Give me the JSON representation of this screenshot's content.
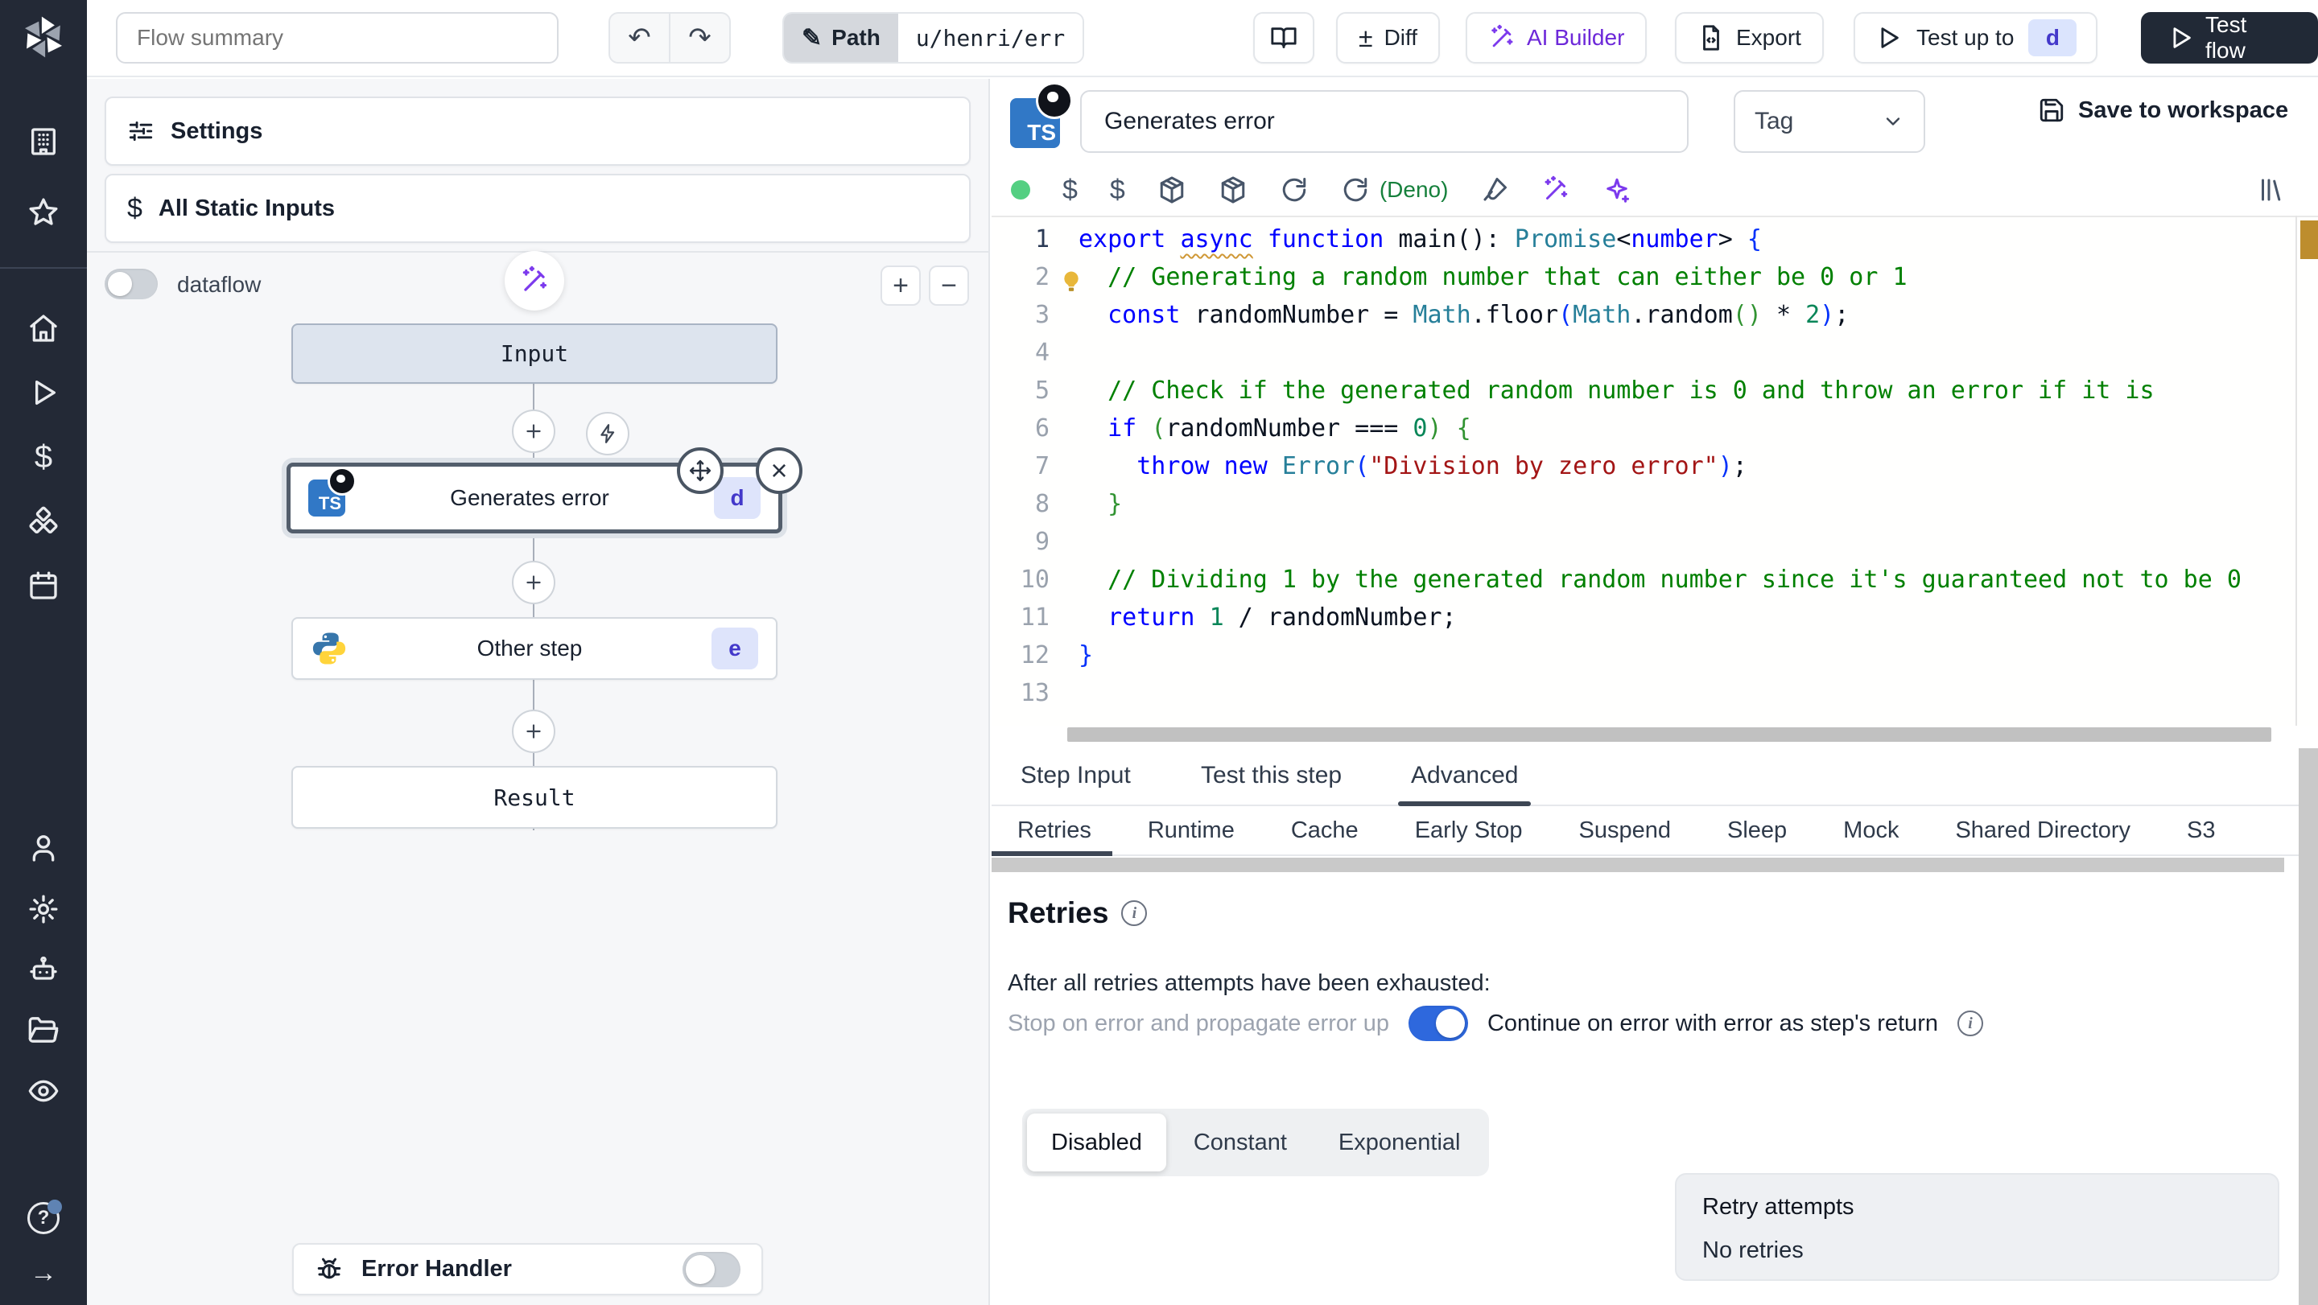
{
  "header": {
    "flow_summary_placeholder": "Flow summary",
    "path_label": "Path",
    "path_value": "u/henri/err",
    "undo_glyph": "↶",
    "redo_glyph": "↷",
    "diff_label": "Diff",
    "diff_glyph": "±",
    "ai_builder_label": "AI Builder",
    "export_label": "Export",
    "test_up_to_label": "Test up to",
    "test_up_to_badge": "d",
    "test_flow_label": "Test flow"
  },
  "flow_panel": {
    "settings_label": "Settings",
    "all_static_inputs_label": "All Static Inputs",
    "dataflow_label": "dataflow",
    "graph": {
      "input_label": "Input",
      "step1_label": "Generates error",
      "step1_badge": "d",
      "step2_label": "Other step",
      "step2_badge": "e",
      "result_label": "Result",
      "close_glyph": "×"
    },
    "error_handler_label": "Error Handler"
  },
  "step_editor": {
    "ts_logo_text": "TS",
    "title_value": "Generates error",
    "tag_placeholder": "Tag",
    "save_label": "Save to workspace",
    "language_label": "(Deno)",
    "tabs": [
      "Step Input",
      "Test this step",
      "Advanced"
    ],
    "active_tab": "Advanced",
    "subtabs": [
      "Retries",
      "Runtime",
      "Cache",
      "Early Stop",
      "Suspend",
      "Sleep",
      "Mock",
      "Shared Directory",
      "S3"
    ],
    "active_subtab": "Retries",
    "code": {
      "lines": [
        {
          "n": 1,
          "t": [
            [
              "kw",
              "export"
            ],
            [
              "pl",
              " "
            ],
            [
              "kww",
              "async"
            ],
            [
              "pl",
              " "
            ],
            [
              "kw",
              "function"
            ],
            [
              "pl",
              " main(): "
            ],
            [
              "ty",
              "Promise"
            ],
            [
              "pl",
              "<"
            ],
            [
              "kw",
              "number"
            ],
            [
              "pl",
              "> "
            ],
            [
              "br1",
              "{"
            ]
          ]
        },
        {
          "n": 2,
          "t": [
            [
              "com",
              "  // Generating a random number that can either be 0 or 1"
            ]
          ]
        },
        {
          "n": 3,
          "t": [
            [
              "pl",
              "  "
            ],
            [
              "kw",
              "const"
            ],
            [
              "pl",
              " randomNumber = "
            ],
            [
              "ty",
              "Math"
            ],
            [
              "pl",
              ".floor"
            ],
            [
              "br1",
              "("
            ],
            [
              "ty",
              "Math"
            ],
            [
              "pl",
              ".random"
            ],
            [
              "br2",
              "()"
            ],
            [
              "pl",
              " * "
            ],
            [
              "num",
              "2"
            ],
            [
              "br1",
              ")"
            ],
            [
              "pl",
              ";"
            ]
          ]
        },
        {
          "n": 4,
          "t": []
        },
        {
          "n": 5,
          "t": [
            [
              "com",
              "  // Check if the generated random number is 0 and throw an error if it is"
            ]
          ]
        },
        {
          "n": 6,
          "t": [
            [
              "pl",
              "  "
            ],
            [
              "kw",
              "if"
            ],
            [
              "pl",
              " "
            ],
            [
              "br2",
              "("
            ],
            [
              "pl",
              "randomNumber === "
            ],
            [
              "num",
              "0"
            ],
            [
              "br2",
              ")"
            ],
            [
              "pl",
              " "
            ],
            [
              "br2",
              "{"
            ]
          ]
        },
        {
          "n": 7,
          "t": [
            [
              "pl",
              "    "
            ],
            [
              "kw",
              "throw"
            ],
            [
              "pl",
              " "
            ],
            [
              "kw",
              "new"
            ],
            [
              "pl",
              " "
            ],
            [
              "ty",
              "Error"
            ],
            [
              "br1",
              "("
            ],
            [
              "str",
              "\"Division by zero error\""
            ],
            [
              "br1",
              ")"
            ],
            [
              "pl",
              ";"
            ]
          ]
        },
        {
          "n": 8,
          "t": [
            [
              "pl",
              "  "
            ],
            [
              "br2",
              "}"
            ]
          ]
        },
        {
          "n": 9,
          "t": []
        },
        {
          "n": 10,
          "t": [
            [
              "com",
              "  // Dividing 1 by the generated random number since it's guaranteed not to be 0"
            ]
          ]
        },
        {
          "n": 11,
          "t": [
            [
              "pl",
              "  "
            ],
            [
              "kw",
              "return"
            ],
            [
              "pl",
              " "
            ],
            [
              "num",
              "1"
            ],
            [
              "pl",
              " / randomNumber;"
            ]
          ]
        },
        {
          "n": 12,
          "t": [
            [
              "br1",
              "}"
            ]
          ]
        },
        {
          "n": 13,
          "t": []
        }
      ]
    }
  },
  "retries_section": {
    "heading": "Retries",
    "exhausted_label": "After all retries attempts have been exhausted:",
    "stop_option": "Stop on error and propagate error up",
    "continue_option": "Continue on error with error as step's return",
    "strategies": [
      "Disabled",
      "Constant",
      "Exponential"
    ],
    "active_strategy": "Disabled",
    "retry_attempts_label": "Retry attempts",
    "retry_attempts_value": "No retries"
  },
  "colors": {
    "sidebar_bg": "#232936",
    "accent_purple": "#7c3aed",
    "toggle_on_blue": "#2e68dd",
    "deno_green": "#16803c",
    "ts_blue": "#3178c6",
    "badge_bg": "#dee4fb",
    "badge_text": "#4338ca",
    "status_green": "#54cf82",
    "ruler_mark": "#bd8d2e"
  }
}
